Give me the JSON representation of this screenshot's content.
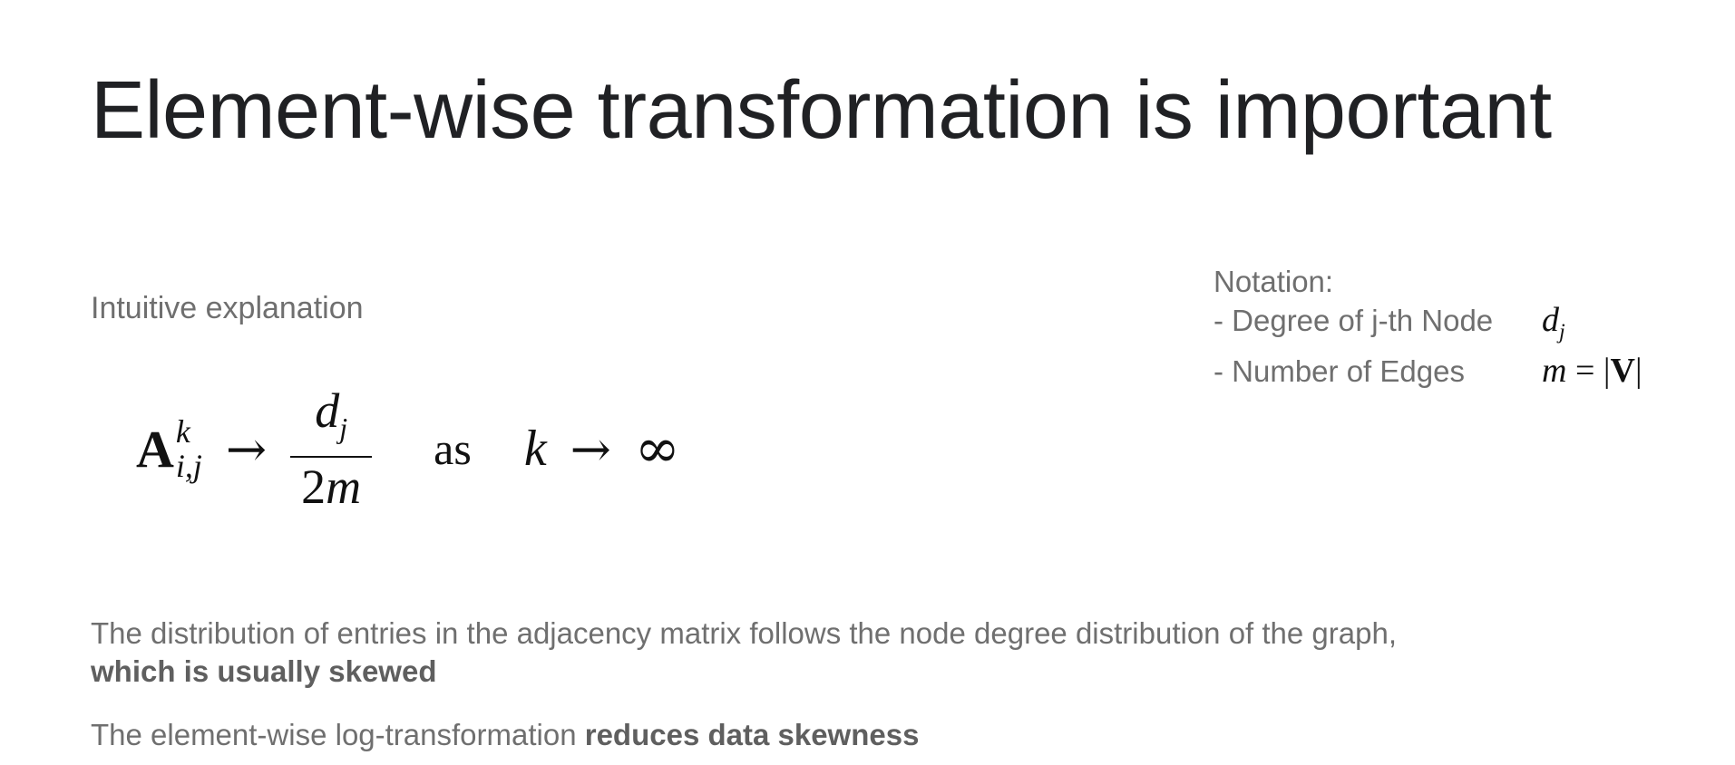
{
  "slide": {
    "title": "Element-wise transformation is important",
    "subtitle": "Intuitive explanation",
    "formula": {
      "matrix": "A",
      "superscript": "k",
      "subscript": "i,j",
      "arrow": "→",
      "numerator": "d",
      "numerator_sub": "j",
      "denominator_coeff": "2",
      "denominator_var": "m",
      "as_word": "as",
      "limit_var": "k",
      "limit_arrow": "→",
      "infinity": "∞"
    },
    "notation": {
      "header": "Notation:",
      "items": [
        {
          "label": "- Degree of j-th Node",
          "symbol": "d",
          "symbol_sub": "j"
        },
        {
          "label": "- Number of Edges",
          "symbol_lhs": "m",
          "symbol_eq": " = |",
          "symbol_bold": "V",
          "symbol_end": "|"
        }
      ]
    },
    "paragraph1": {
      "text": "The distribution of entries in the adjacency matrix follows the node degree distribution of the graph,",
      "bold": "which is usually skewed"
    },
    "paragraph2": {
      "text": "The element-wise log-transformation ",
      "bold": "reduces data skewness"
    }
  }
}
